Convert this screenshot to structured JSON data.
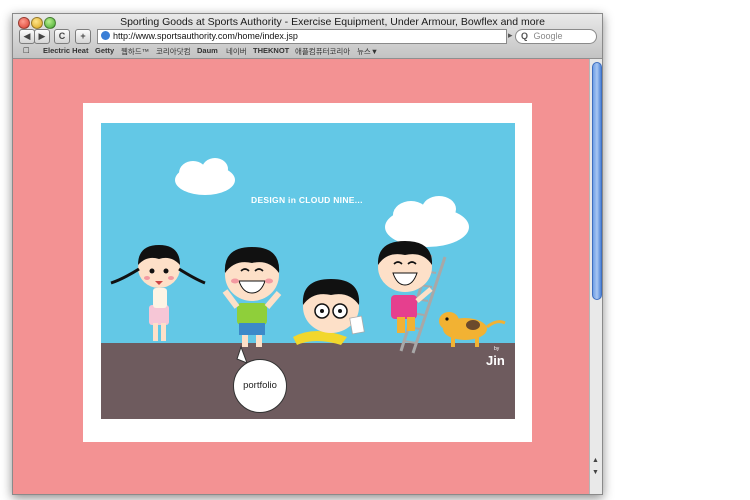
{
  "window": {
    "title": "Sporting Goods at Sports Authority - Exercise Equipment, Under Armour, Bowflex and more"
  },
  "toolbar": {
    "back_glyph": "◀",
    "forward_glyph": "▶",
    "reload_glyph": "C",
    "add_glyph": "+",
    "url": "http://www.sportsauthority.com/home/index.jsp",
    "search_placeholder": "Google",
    "search_glyph": "Q"
  },
  "bookmarks": {
    "book_icon_glyph": "☐",
    "items": [
      "Electric Heat",
      "Getty",
      "웹하드™",
      "코리아닷컴",
      "Daum",
      "네이버",
      "THEKNOT",
      "애플컴퓨터코리아",
      "뉴스▼"
    ]
  },
  "page": {
    "headline": "DESIGN in CLOUD NINE...",
    "portfolio_label": "portfolio",
    "signature": "Jin",
    "signature_small": "by"
  },
  "colors": {
    "page_background": "#f39293",
    "sky": "#63c8e6",
    "ground": "#6e5b5e"
  },
  "icons": {
    "globe": "globe-icon",
    "book": "book-icon"
  }
}
